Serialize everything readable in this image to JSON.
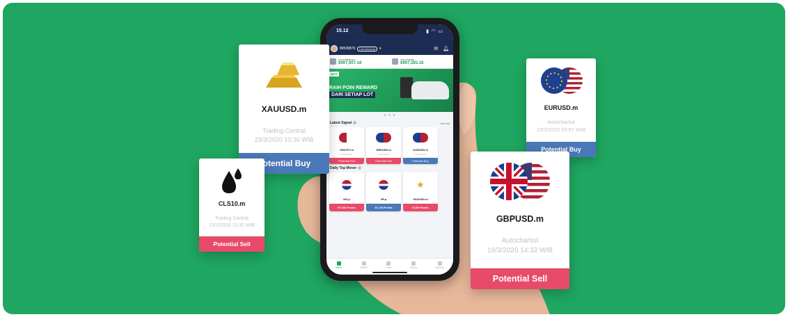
{
  "colors": {
    "background": "#1fa660",
    "buy": "#4a78b8",
    "sell": "#e84a6a",
    "app_header": "#1d2c52"
  },
  "phone": {
    "status_time": "15.12",
    "account_id": "88599876",
    "account_type": "Live Account",
    "balance_label": "Your Balance",
    "balance_value": "$997,907.18",
    "equity_label": "Your Equity",
    "equity_value": "$997,385.18",
    "promo_line1": "RAIH POIN REWARD",
    "promo_line2": "DARI SETIAP LOT",
    "latest_signal_title": "Latest Signal",
    "view_all": "View All",
    "signals": [
      {
        "symbol": "USDJPY.m",
        "source": "Autochartist",
        "action": "Potential Sell",
        "type": "sell"
      },
      {
        "symbol": "GBPUSD.m",
        "source": "Autochartist",
        "action": "Potential Sell",
        "type": "sell"
      },
      {
        "symbol": "AUDUSD.m",
        "source": "Autochartist",
        "action": "Potential Buy",
        "type": "buy"
      }
    ],
    "top_mover_title": "Daily Top Mover",
    "movers": [
      {
        "symbol": "NG.p",
        "points": "57,026 Points"
      },
      {
        "symbol": "SP.p",
        "points": "10,725 Points"
      },
      {
        "symbol": "XAUUSD.m",
        "points": "5,150 Points"
      }
    ],
    "tabs": [
      "Home",
      "Market",
      "Trade",
      "History",
      "Account"
    ]
  },
  "cards": {
    "xau": {
      "symbol": "XAUUSD.m",
      "source": "Trading Central",
      "datetime": "23/3/2020 10:30 WIB",
      "action": "Potential Buy"
    },
    "cls": {
      "symbol": "CLS10.m",
      "source": "Trading Central",
      "datetime": "23/3/2020 10:30 WIB",
      "action": "Potential Sell"
    },
    "eur": {
      "symbol": "EURUSD.m",
      "source": "Autochartist",
      "datetime": "23/3/2020 10:57 WIB",
      "action": "Potential Buy"
    },
    "gbp": {
      "symbol": "GBPUSD.m",
      "source": "Autochartist",
      "datetime": "18/3/2020 14:32 WIB",
      "action": "Potential Sell"
    }
  }
}
